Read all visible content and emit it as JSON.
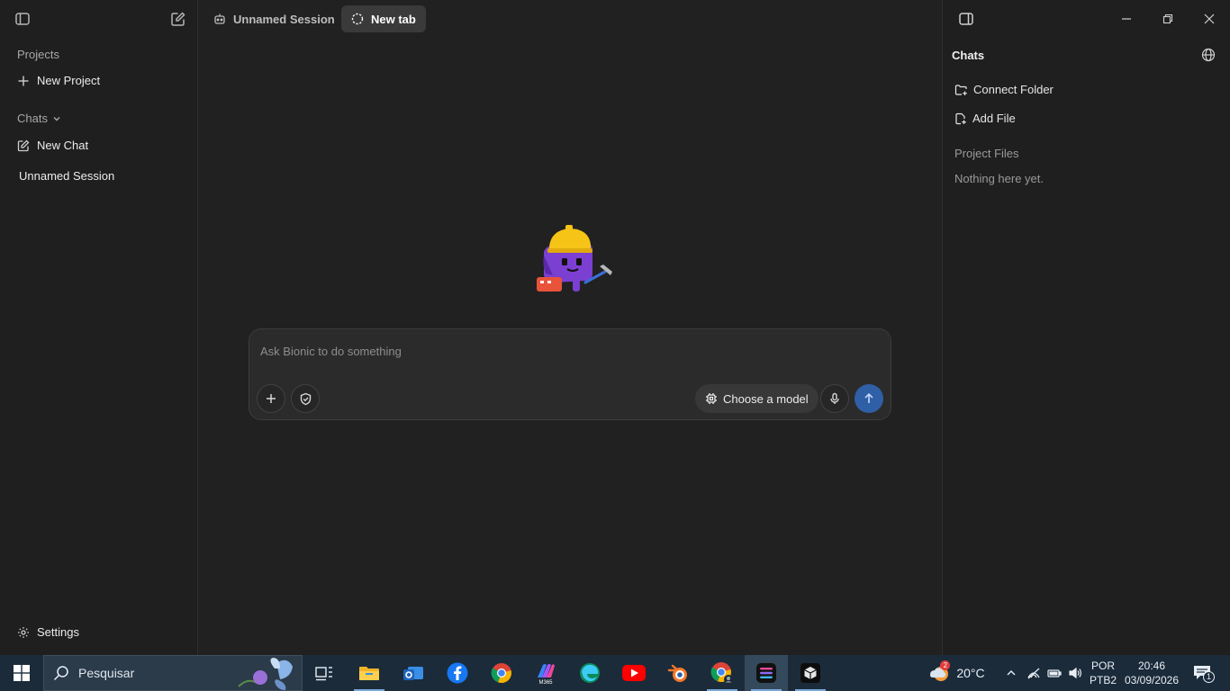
{
  "sidebar": {
    "projects_label": "Projects",
    "new_project_label": "New Project",
    "chats_label": "Chats",
    "new_chat_label": "New Chat",
    "sessions": [
      "Unnamed Session"
    ],
    "settings_label": "Settings"
  },
  "tabs": [
    {
      "label": "Unnamed Session",
      "icon": "bot-icon",
      "active": false
    },
    {
      "label": "New tab",
      "icon": "dashed-circle-icon",
      "active": true
    }
  ],
  "composer": {
    "placeholder": "Ask Bionic to do something",
    "model_label": "Choose a model",
    "accent": "#2f5fa6"
  },
  "right_panel": {
    "title": "Chats",
    "connect_folder_label": "Connect Folder",
    "add_file_label": "Add File",
    "project_files_label": "Project Files",
    "empty_label": "Nothing here yet."
  },
  "taskbar": {
    "search_placeholder": "Pesquisar",
    "weather_temp": "20°C",
    "weather_badge": "2",
    "lang_top": "POR",
    "lang_bottom": "PTB2",
    "time": "20:46",
    "date": "03/09/2026",
    "notifications_count": "1"
  }
}
